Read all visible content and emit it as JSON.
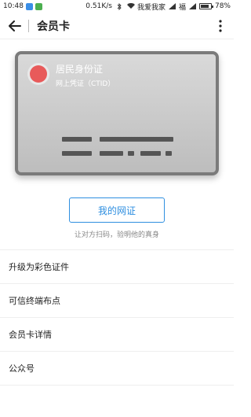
{
  "status_bar": {
    "time": "10:48",
    "speed": "0.51K/s",
    "carrier1": "我爱我家",
    "carrier2": "福",
    "battery": "78%"
  },
  "header": {
    "title": "会员卡"
  },
  "card": {
    "name": "居民身份证",
    "subtitle": "网上凭证（CTID）"
  },
  "action": {
    "button_label": "我的网证",
    "hint": "让对方扫码，验明他的真身"
  },
  "list": [
    {
      "label": "升级为彩色证件"
    },
    {
      "label": "可信终端布点"
    },
    {
      "label": "会员卡详情"
    },
    {
      "label": "公众号"
    }
  ],
  "colors": {
    "accent": "#2f8fe0",
    "avatar": "#e85a5a"
  }
}
